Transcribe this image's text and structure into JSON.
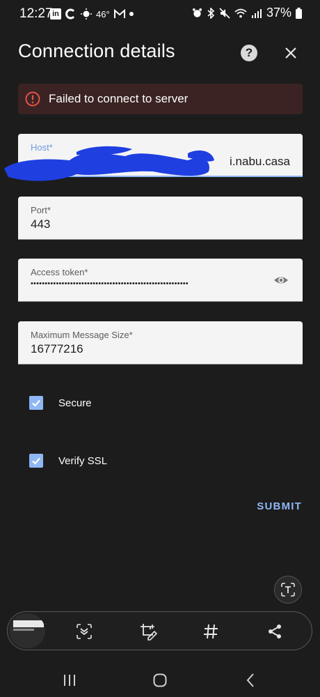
{
  "status_bar": {
    "time": "12:27",
    "temperature": "46°",
    "battery": "37%"
  },
  "header": {
    "title": "Connection details",
    "help_icon": "help-circle-icon",
    "close_icon": "close-icon"
  },
  "error": {
    "message": "Failed to connect to server",
    "icon": "error-circle-icon",
    "color": "#e5534b"
  },
  "form": {
    "host": {
      "label": "Host*",
      "value": "i.nabu.casa"
    },
    "port": {
      "label": "Port*",
      "value": "443"
    },
    "access_token": {
      "label": "Access token*",
      "value": "••••••••••••••••••••••••••••••••••••••••••••••••••••••••",
      "toggle_icon": "eye-icon"
    },
    "max_message_size": {
      "label": "Maximum Message Size*",
      "value": "16777216"
    },
    "secure": {
      "label": "Secure",
      "checked": true
    },
    "verify_ssl": {
      "label": "Verify SSL",
      "checked": true
    },
    "submit_label": "SUBMIT"
  },
  "colors": {
    "background": "#1c1c1c",
    "accent": "#8fb7f5",
    "field_background": "#f4f4f4",
    "error_background": "#3a2322",
    "redaction": "#1f3fe0"
  },
  "screenshot_toolbar": {
    "icons": [
      "scroll-capture-icon",
      "crop-edit-icon",
      "hashtag-icon",
      "share-icon"
    ]
  },
  "nav_bar": {
    "icons": [
      "recent-apps-icon",
      "home-icon",
      "back-icon"
    ]
  }
}
